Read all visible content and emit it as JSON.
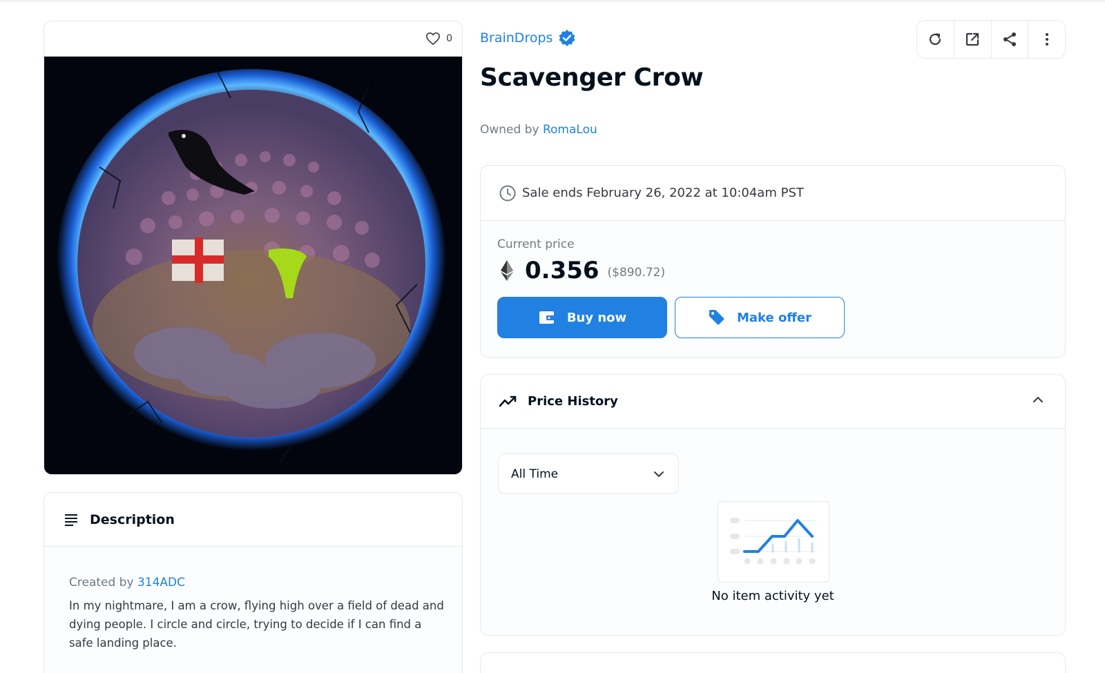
{
  "asset": {
    "favorite_count": "0",
    "image_alt": "Scavenger Crow artwork"
  },
  "description": {
    "title": "Description",
    "created_by_prefix": "Created by",
    "creator": "314ADC",
    "text": "In my nightmare, I am a crow, flying high over a field of dead and dying people. I circle and circle, trying to decide if I can find a safe landing place."
  },
  "collection": {
    "name": "BrainDrops",
    "verified": true
  },
  "toolbar": {
    "buttons": [
      "refresh-icon",
      "external-link-icon",
      "share-icon",
      "more-options-icon"
    ]
  },
  "item": {
    "title": "Scavenger Crow",
    "owned_by_prefix": "Owned by",
    "owner": "RomaLou"
  },
  "sale": {
    "ends_text": "Sale ends February 26, 2022 at 10:04am PST",
    "price_label": "Current price",
    "price": "0.356",
    "price_usd": "($890.72)",
    "buy_label": "Buy now",
    "offer_label": "Make offer"
  },
  "history": {
    "title": "Price History",
    "range_selected": "All Time",
    "empty_text": "No item activity yet"
  },
  "colors": {
    "accent": "#2081e2",
    "text_primary": "#04111d",
    "text_secondary": "#707a83",
    "border": "#e5e8eb"
  }
}
